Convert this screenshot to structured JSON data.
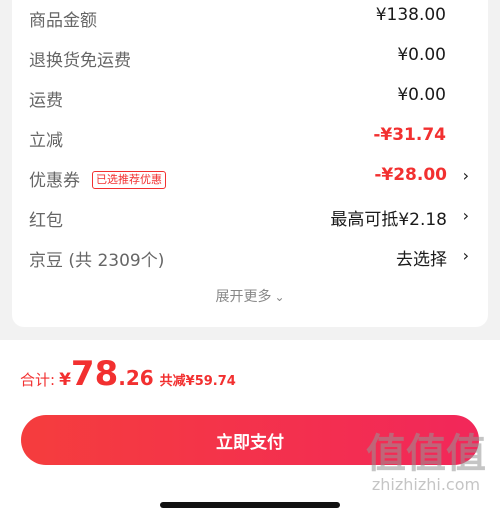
{
  "summary": {
    "rows": [
      {
        "label": "商品金额",
        "value": "¥138.00"
      },
      {
        "label": "退换货免运费",
        "value": "¥0.00"
      },
      {
        "label": "运费",
        "value": "¥0.00"
      },
      {
        "label": "立减",
        "value": "-¥31.74"
      },
      {
        "label": "优惠券",
        "tag": "已选推荐优惠",
        "value": "-¥28.00",
        "arrow": "›"
      },
      {
        "label": "红包",
        "value": "最高可抵¥2.18",
        "arrow": "›"
      },
      {
        "label": "京豆 (共 2309个)",
        "value": "去选择",
        "arrow": "›"
      }
    ],
    "expand_more": "展开更多",
    "expand_icon": "chevron-down-icon"
  },
  "footer": {
    "total_label": "合计:",
    "currency": "¥",
    "total_int": "78",
    "total_dec": ".26",
    "saved": "共减¥59.74",
    "pay_button": "立即支付"
  },
  "watermark": {
    "chars": "值值值",
    "domain": "zhizhizhi.com"
  },
  "colors": {
    "accent_red": "#f23030",
    "button_gradient_start": "#f53d3d",
    "button_gradient_end": "#f2275a",
    "background": "#f2f2f2"
  }
}
